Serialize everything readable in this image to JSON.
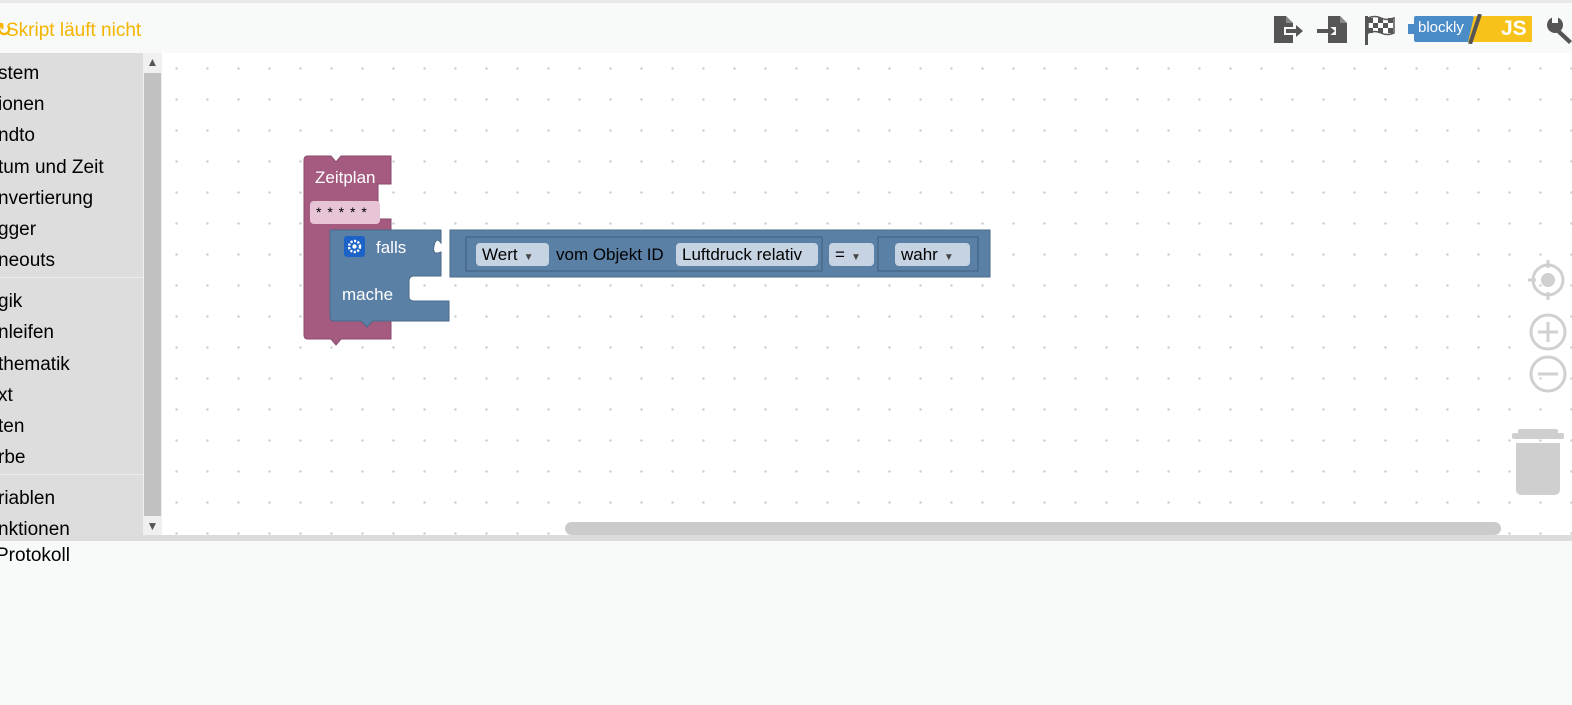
{
  "toolbar": {
    "status_text": "Skript läuft nicht",
    "badge_left": "blockly",
    "badge_right": "JS",
    "icons": [
      "export-icon",
      "import-icon",
      "flag-icon",
      "blockly-js-toggle-icon",
      "wrench-icon"
    ]
  },
  "sidebar": {
    "items": [
      "stem",
      "ionen",
      "ndto",
      "tum und Zeit",
      "nvertierung",
      "gger",
      "neouts",
      "gik",
      "nleifen",
      "thematik",
      "xt",
      "ten",
      "rbe",
      "riablen",
      "nktionen"
    ]
  },
  "blocks": {
    "schedule_label": "Zeitplan",
    "schedule_value": "* * * * *",
    "if_label": "falls",
    "do_label": "mache",
    "value_dropdown": "Wert",
    "of_object_label": "vom Objekt ID",
    "object_id": "Luftdruck relativ",
    "operator": "=",
    "compare_value": "wahr"
  },
  "log": {
    "tab_label": "Protokoll"
  },
  "colors": {
    "status": "#f4b400",
    "schedule_block": "#a55b80",
    "logic_block": "#5b80a5",
    "sidebar_bg": "#dddddd"
  }
}
